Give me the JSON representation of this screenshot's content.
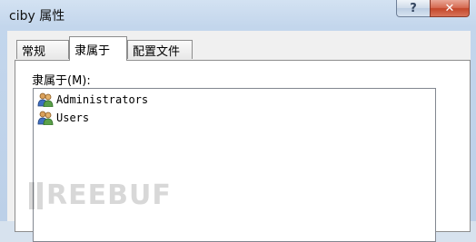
{
  "window": {
    "title": "ciby 属性",
    "help_label": "?",
    "close_label": "✕"
  },
  "tabs": [
    {
      "label": "常规"
    },
    {
      "label": "隶属于",
      "selected": true
    },
    {
      "label": "配置文件"
    }
  ],
  "member_of": {
    "label": "隶属于(M):",
    "groups": [
      {
        "name": "Administrators",
        "icon": "group-icon"
      },
      {
        "name": "Users",
        "icon": "group-icon"
      }
    ]
  },
  "watermark": {
    "text": "REEBUF"
  },
  "colors": {
    "title_gradient_top": "#d3e2f2",
    "close_button": "#c3462a",
    "panel_background": "#ffffff",
    "dialog_background": "#f0f0f0"
  }
}
